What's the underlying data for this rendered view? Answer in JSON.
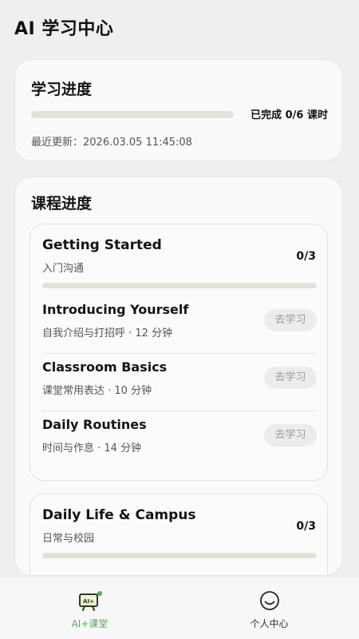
{
  "header": {
    "title": "AI 学习中心"
  },
  "progress_card": {
    "title": "学习进度",
    "completed": 0,
    "total": 6,
    "status_text": "已完成 0/6 课时",
    "updated_text": "最近更新：2026.03.05 11:45:08"
  },
  "courses_card": {
    "title": "课程进度",
    "modules": [
      {
        "name": "Getting Started",
        "subtitle": "入门沟通",
        "count": "0/3",
        "progress": 0,
        "lessons": [
          {
            "name": "Introducing Yourself",
            "meta": "自我介绍与打招呼 · 12 分钟",
            "button": "去学习"
          },
          {
            "name": "Classroom Basics",
            "meta": "课堂常用表达 · 10 分钟",
            "button": "去学习"
          },
          {
            "name": "Daily Routines",
            "meta": "时间与作息 · 14 分钟",
            "button": "去学习"
          }
        ]
      },
      {
        "name": "Daily Life & Campus",
        "subtitle": "日常与校园",
        "count": "0/3",
        "progress": 0
      }
    ]
  },
  "nav": {
    "items": [
      {
        "label": "AI+课堂",
        "icon": "ai-tv-icon",
        "active": true
      },
      {
        "label": "个人中心",
        "icon": "smiley-icon",
        "active": false
      }
    ]
  },
  "colors": {
    "accent": "#4caf50",
    "bar_track": "#e3e2d7",
    "background": "#efefef"
  }
}
